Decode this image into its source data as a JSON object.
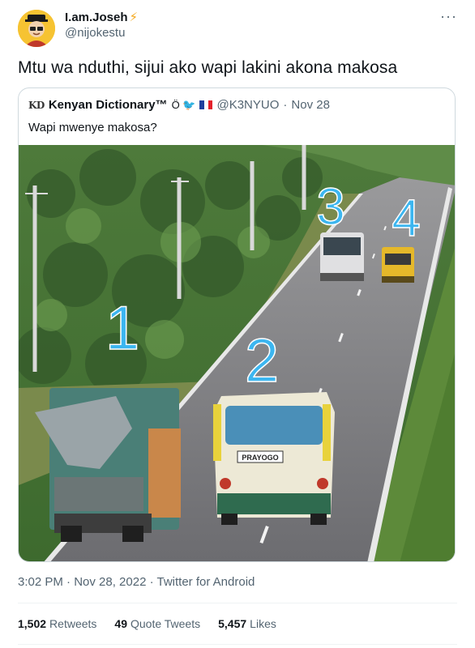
{
  "author": {
    "display_name": "I.am.Joseh",
    "badge_icon": "lightning-icon",
    "handle": "@nijokestu",
    "avatar_bg": "#f6c332"
  },
  "more_icon": "more-horizontal-icon",
  "tweet_text": "Mtu wa nduthi, sijui ako wapi lakini akona makosa",
  "quote": {
    "logo": "KD",
    "name": "Kenyan Dictionary™",
    "emojis": "Ö 🐦",
    "flag": "french-flag-icon",
    "handle": "@K3NYUO",
    "dot": "·",
    "date": "Nov 28",
    "text": "Wapi mwenye makosa?",
    "image": {
      "labels": [
        "1",
        "2",
        "3",
        "4"
      ],
      "bus_sign": "PRAYOGO"
    }
  },
  "meta": "3:02 PM · Nov 28, 2022 · Twitter for Android",
  "stats": {
    "retweets_count": "1,502",
    "retweets_label": "Retweets",
    "quotes_count": "49",
    "quotes_label": "Quote Tweets",
    "likes_count": "5,457",
    "likes_label": "Likes"
  },
  "colors": {
    "text": "#0f1419",
    "muted": "#536471",
    "border": "#cfd9de",
    "label_blue": "#3cb6f0"
  }
}
